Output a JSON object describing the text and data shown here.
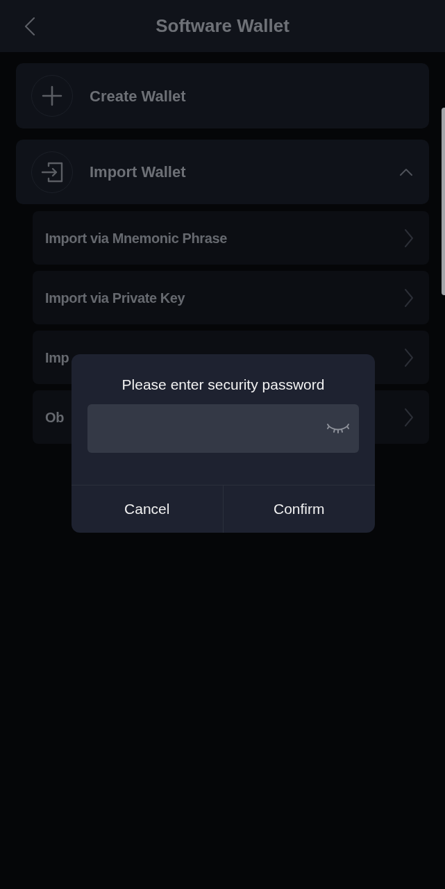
{
  "header": {
    "title": "Software Wallet"
  },
  "menu": [
    {
      "kind": "action",
      "label": "Create Wallet"
    },
    {
      "kind": "group",
      "label": "Import Wallet",
      "expanded": true,
      "children": [
        {
          "label": "Import via Mnemonic Phrase"
        },
        {
          "label": "Import via Private Key"
        },
        {
          "label": "Imp"
        },
        {
          "label": "Ob"
        }
      ]
    }
  ],
  "dialog": {
    "title": "Please enter security password",
    "password_visible": false,
    "buttons": [
      "Cancel",
      "Confirm"
    ]
  }
}
